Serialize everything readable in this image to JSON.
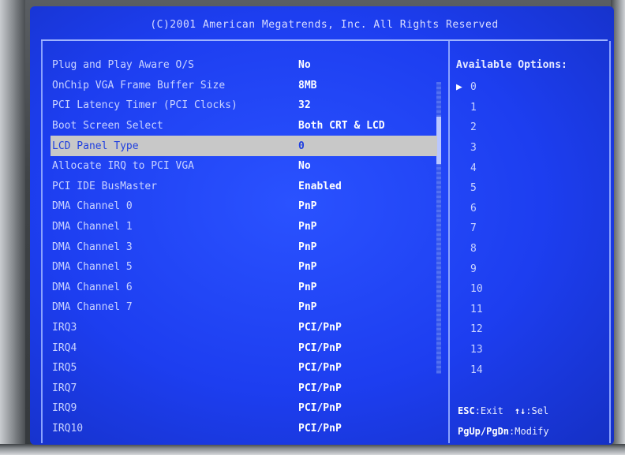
{
  "header": {
    "copyright": "(C)2001 American Megatrends, Inc. All Rights Reserved"
  },
  "settings": [
    {
      "label": "Plug and Play Aware O/S",
      "value": "No"
    },
    {
      "label": "OnChip VGA Frame Buffer Size",
      "value": "8MB"
    },
    {
      "label": "PCI Latency Timer (PCI Clocks)",
      "value": "32"
    },
    {
      "label": "Boot Screen Select",
      "value": "Both CRT & LCD"
    },
    {
      "label": "LCD Panel Type",
      "value": "0",
      "selected": true
    },
    {
      "label": "Allocate IRQ to PCI VGA",
      "value": "No"
    },
    {
      "label": "PCI IDE BusMaster",
      "value": "Enabled"
    },
    {
      "label": "DMA Channel 0",
      "value": "PnP"
    },
    {
      "label": "DMA Channel 1",
      "value": "PnP"
    },
    {
      "label": "DMA Channel 3",
      "value": "PnP"
    },
    {
      "label": "DMA Channel 5",
      "value": "PnP"
    },
    {
      "label": "DMA Channel 6",
      "value": "PnP"
    },
    {
      "label": "DMA Channel 7",
      "value": "PnP"
    },
    {
      "label": "IRQ3",
      "value": "PCI/PnP"
    },
    {
      "label": "IRQ4",
      "value": "PCI/PnP"
    },
    {
      "label": "IRQ5",
      "value": "PCI/PnP"
    },
    {
      "label": "IRQ7",
      "value": "PCI/PnP"
    },
    {
      "label": "IRQ9",
      "value": "PCI/PnP"
    },
    {
      "label": "IRQ10",
      "value": "PCI/PnP"
    }
  ],
  "help": {
    "title": "Available Options:",
    "options": [
      "0",
      "1",
      "2",
      "3",
      "4",
      "5",
      "6",
      "7",
      "8",
      "9",
      "10",
      "11",
      "12",
      "13",
      "14"
    ],
    "selected_marker": "▶",
    "selected_index": 0
  },
  "keys": {
    "esc_key": "ESC",
    "esc_action": "Exit",
    "sel_key": "↑↓",
    "sel_action": "Sel",
    "page_key": "PgUp/PgDn",
    "page_action": "Modify"
  },
  "colors": {
    "background": "#1f3fe0",
    "highlight": "#c8c8c8",
    "label_text": "#c9d3ff",
    "value_text": "#ffffff"
  }
}
